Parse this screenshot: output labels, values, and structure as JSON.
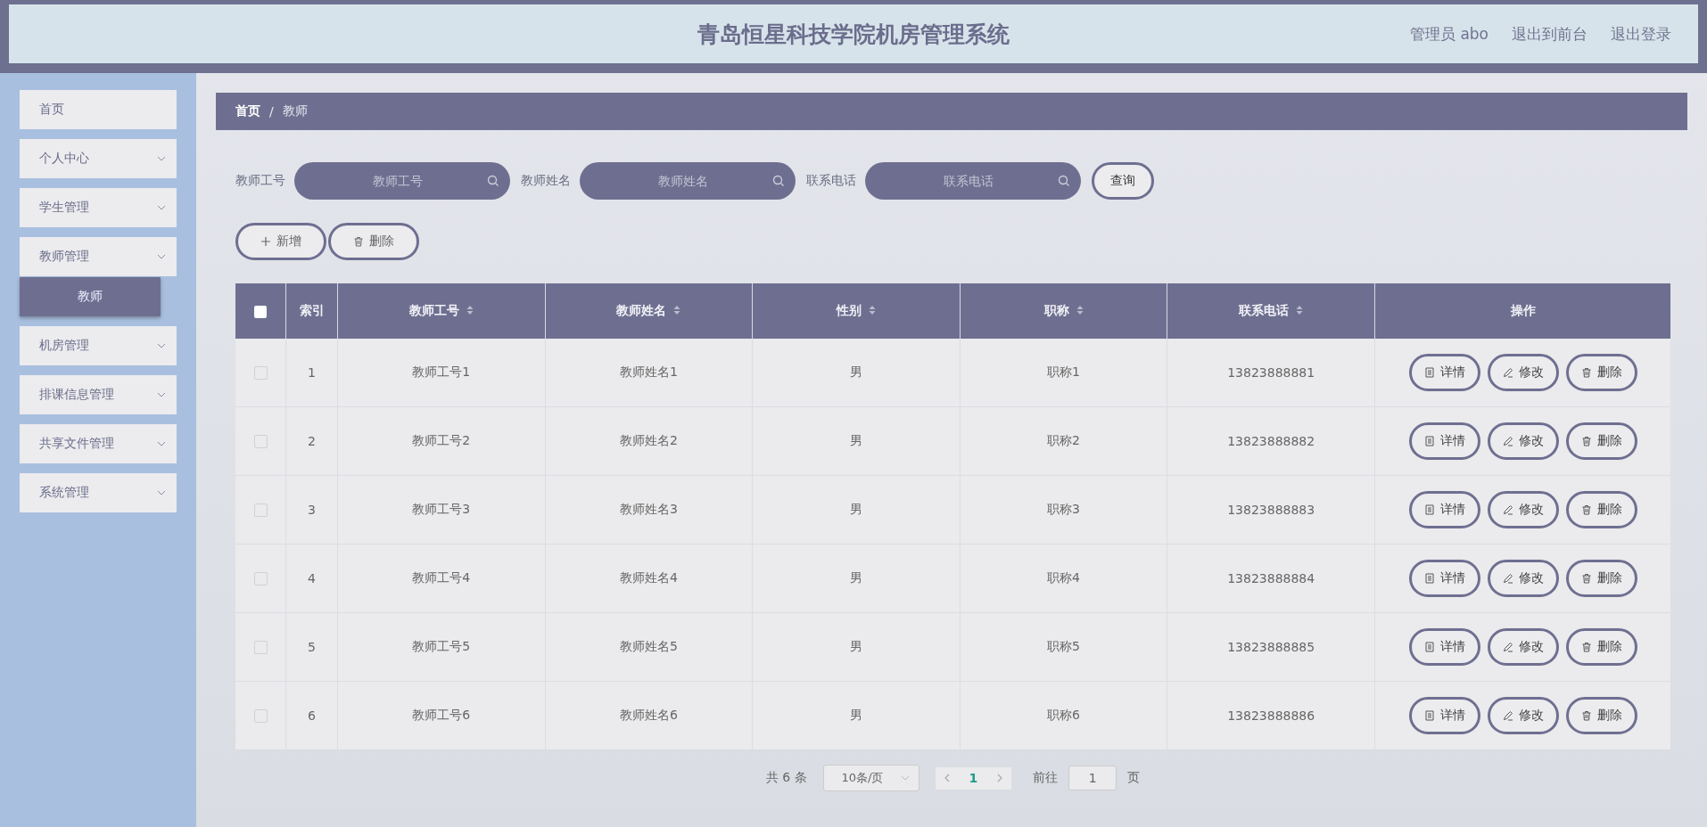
{
  "header": {
    "title": "青岛恒星科技学院机房管理系统",
    "links": [
      "管理员 abo",
      "退出到前台",
      "退出登录"
    ]
  },
  "sidebar": {
    "items": [
      {
        "label": "首页",
        "kind": "link"
      },
      {
        "label": "个人中心",
        "kind": "group"
      },
      {
        "label": "学生管理",
        "kind": "group"
      },
      {
        "label": "教师管理",
        "kind": "group",
        "children": [
          {
            "label": "教师",
            "selected": true
          }
        ]
      },
      {
        "label": "机房管理",
        "kind": "group"
      },
      {
        "label": "排课信息管理",
        "kind": "group"
      },
      {
        "label": "共享文件管理",
        "kind": "group"
      },
      {
        "label": "系统管理",
        "kind": "group"
      }
    ]
  },
  "breadcrumb": [
    "首页",
    "/",
    "教师"
  ],
  "search": {
    "fields": [
      {
        "label": "教师工号",
        "placeholder": "教师工号"
      },
      {
        "label": "教师姓名",
        "placeholder": "教师姓名"
      },
      {
        "label": "联系电话",
        "placeholder": "联系电话"
      }
    ],
    "button": "查询"
  },
  "actions": [
    {
      "kind": "add",
      "label": "新增"
    },
    {
      "kind": "delete",
      "label": "删除"
    }
  ],
  "table": {
    "header_checked": false,
    "columns": [
      {
        "label": "索引",
        "sortable": false
      },
      {
        "label": "教师工号",
        "sortable": true
      },
      {
        "label": "教师姓名",
        "sortable": true
      },
      {
        "label": "性别",
        "sortable": true
      },
      {
        "label": "职称",
        "sortable": true
      },
      {
        "label": "联系电话",
        "sortable": true
      },
      {
        "label": "操作",
        "sortable": false
      }
    ],
    "rows": [
      {
        "checked": false,
        "cells": [
          "1",
          "教师工号1",
          "教师姓名1",
          "男",
          "职称1",
          "13823888881"
        ],
        "actions": [
          {
            "kind": "detail",
            "label": "详情"
          },
          {
            "kind": "edit",
            "label": "修改"
          },
          {
            "kind": "delete",
            "label": "删除"
          }
        ]
      },
      {
        "checked": false,
        "cells": [
          "2",
          "教师工号2",
          "教师姓名2",
          "男",
          "职称2",
          "13823888882"
        ],
        "actions": [
          {
            "kind": "detail",
            "label": "详情"
          },
          {
            "kind": "edit",
            "label": "修改"
          },
          {
            "kind": "delete",
            "label": "删除"
          }
        ]
      },
      {
        "checked": false,
        "cells": [
          "3",
          "教师工号3",
          "教师姓名3",
          "男",
          "职称3",
          "13823888883"
        ],
        "actions": [
          {
            "kind": "detail",
            "label": "详情"
          },
          {
            "kind": "edit",
            "label": "修改"
          },
          {
            "kind": "delete",
            "label": "删除"
          }
        ]
      },
      {
        "checked": false,
        "cells": [
          "4",
          "教师工号4",
          "教师姓名4",
          "男",
          "职称4",
          "13823888884"
        ],
        "actions": [
          {
            "kind": "detail",
            "label": "详情"
          },
          {
            "kind": "edit",
            "label": "修改"
          },
          {
            "kind": "delete",
            "label": "删除"
          }
        ]
      },
      {
        "checked": false,
        "cells": [
          "5",
          "教师工号5",
          "教师姓名5",
          "男",
          "职称5",
          "13823888885"
        ],
        "actions": [
          {
            "kind": "detail",
            "label": "详情"
          },
          {
            "kind": "edit",
            "label": "修改"
          },
          {
            "kind": "delete",
            "label": "删除"
          }
        ]
      },
      {
        "checked": false,
        "cells": [
          "6",
          "教师工号6",
          "教师姓名6",
          "男",
          "职称6",
          "13823888886"
        ],
        "actions": [
          {
            "kind": "detail",
            "label": "详情"
          },
          {
            "kind": "edit",
            "label": "修改"
          },
          {
            "kind": "delete",
            "label": "删除"
          }
        ]
      }
    ]
  },
  "pagination": {
    "total": "共 6 条",
    "page_size": "10条/页",
    "pages": [
      {
        "label": "1",
        "selected": true
      }
    ],
    "goto_label": "前往",
    "goto_value": "1",
    "goto_suffix": "页"
  }
}
